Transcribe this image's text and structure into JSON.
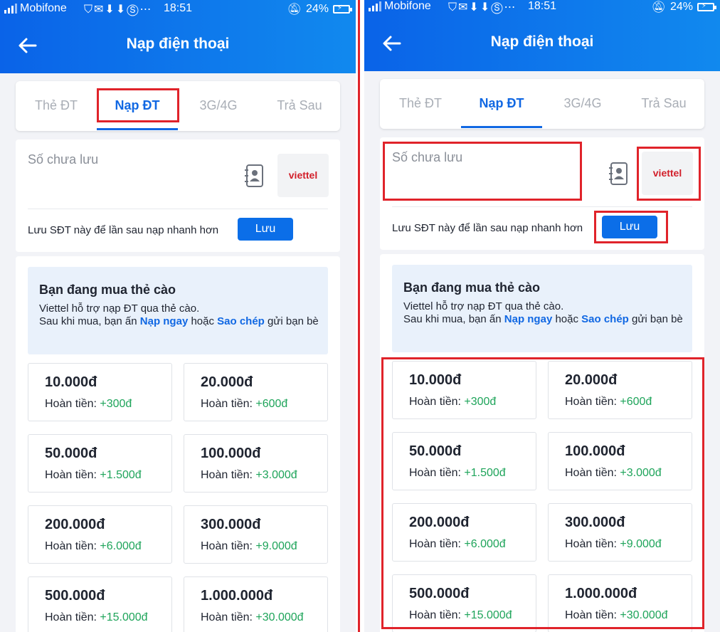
{
  "status_bar": {
    "carrier": "Mobifone",
    "time": "18:51",
    "battery": "24%",
    "icons": [
      "vpn-icon",
      "mail-icon",
      "download-icon",
      "download-box-icon",
      "skype-icon",
      "more-icon"
    ]
  },
  "header": {
    "title": "Nạp điện thoại"
  },
  "tabs": [
    {
      "label": "Thẻ ĐT"
    },
    {
      "label": "Nạp ĐT"
    },
    {
      "label": "3G/4G"
    },
    {
      "label": "Trả Sau"
    }
  ],
  "active_tab": "Nạp ĐT",
  "phone": {
    "placeholder": "Số chưa lưu",
    "carrier_logo": "viettel"
  },
  "save": {
    "text": "Lưu SĐT này để lần sau nạp nhanh hơn",
    "button": "Lưu"
  },
  "info": {
    "title": "Bạn đang mua thẻ cào",
    "line1": "Viettel hỗ trợ nạp ĐT qua thẻ cào.",
    "line2_before": "Sau khi mua, bạn ấn ",
    "link1": "Nạp ngay",
    "line2_mid": " hoặc ",
    "link2": "Sao chép",
    "line2_after": " gửi bạn bè"
  },
  "cashback_label": "Hoàn tiền: ",
  "denominations": [
    {
      "value": "10.000đ",
      "cashback": "+300đ"
    },
    {
      "value": "20.000đ",
      "cashback": "+600đ"
    },
    {
      "value": "50.000đ",
      "cashback": "+1.500đ"
    },
    {
      "value": "100.000đ",
      "cashback": "+3.000đ"
    },
    {
      "value": "200.000đ",
      "cashback": "+6.000đ"
    },
    {
      "value": "300.000đ",
      "cashback": "+9.000đ"
    },
    {
      "value": "500.000đ",
      "cashback": "+15.000đ"
    },
    {
      "value": "1.000.000đ",
      "cashback": "+30.000đ"
    }
  ],
  "colors": {
    "header_start": "#0a63e8",
    "header_end": "#1189ee",
    "accent": "#1168e3",
    "bonus": "#1ea45a",
    "highlight": "#e0232a",
    "viettel": "#d21f2a"
  }
}
